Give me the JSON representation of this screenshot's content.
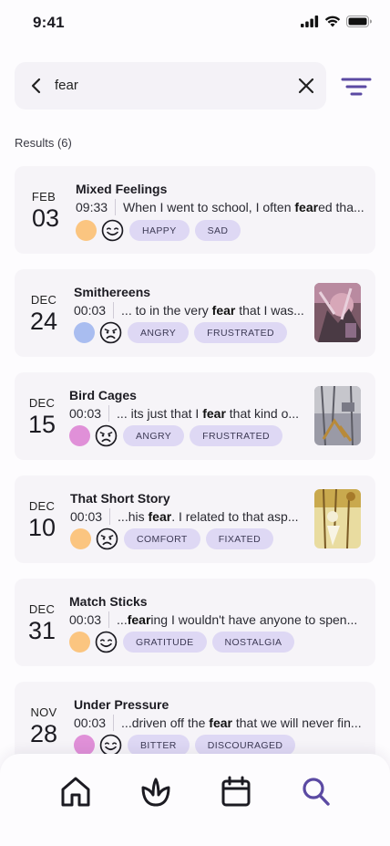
{
  "status": {
    "time": "9:41"
  },
  "search": {
    "query": "fear"
  },
  "results_label": "Results (6)",
  "colors": {
    "accent": "#5b4aa3",
    "tag_bg": "#ded8f4",
    "card_bg": "#f6f4f8"
  },
  "entries": [
    {
      "month": "FEB",
      "day": "03",
      "title": "Mixed Feelings",
      "time": "09:33",
      "excerpt_before": "When I went to school, I often ",
      "excerpt_bold": "fear",
      "excerpt_after": "ed tha...",
      "dot_color": "#fbc580",
      "face": "smile-icon",
      "tags": [
        "HAPPY",
        "SAD"
      ]
    },
    {
      "month": "DEC",
      "day": "24",
      "title": "Smithereens",
      "time": "00:03",
      "excerpt_before": "... to in the very ",
      "excerpt_bold": "fear",
      "excerpt_after": " that I was...",
      "dot_color": "#a9bdf0",
      "face": "worried-face-icon",
      "tags": [
        "ANGRY",
        "FRUSTRATED"
      ]
    },
    {
      "month": "DEC",
      "day": "15",
      "title": "Bird Cages",
      "time": "00:03",
      "excerpt_before": "... its just that I ",
      "excerpt_bold": "fear",
      "excerpt_after": " that kind o...",
      "dot_color": "#e090d8",
      "face": "worried-face-icon",
      "tags": [
        "ANGRY",
        "FRUSTRATED"
      ]
    },
    {
      "month": "DEC",
      "day": "10",
      "title": "That Short Story",
      "time": "00:03",
      "excerpt_before": "...his ",
      "excerpt_bold": "fear",
      "excerpt_after": ". I related to that asp...",
      "dot_color": "#fbc580",
      "face": "worried-face-icon",
      "tags": [
        "COMFORT",
        "FIXATED"
      ]
    },
    {
      "month": "DEC",
      "day": "31",
      "title": "Match Sticks",
      "time": "00:03",
      "excerpt_before": "...",
      "excerpt_bold": "fear",
      "excerpt_after": "ing I wouldn't have anyone to spen...",
      "dot_color": "#fbc580",
      "face": "smile-icon",
      "tags": [
        "GRATITUDE",
        "NOSTALGIA"
      ]
    },
    {
      "month": "NOV",
      "day": "28",
      "title": "Under Pressure",
      "time": "00:03",
      "excerpt_before": "...driven off the ",
      "excerpt_bold": "fear",
      "excerpt_after": " that we will never fin...",
      "dot_color": "#e090d8",
      "face": "smile-icon",
      "tags": [
        "BITTER",
        "DISCOURAGED"
      ]
    }
  ],
  "nav": [
    "home-icon",
    "lotus-icon",
    "calendar-icon",
    "search-icon"
  ]
}
